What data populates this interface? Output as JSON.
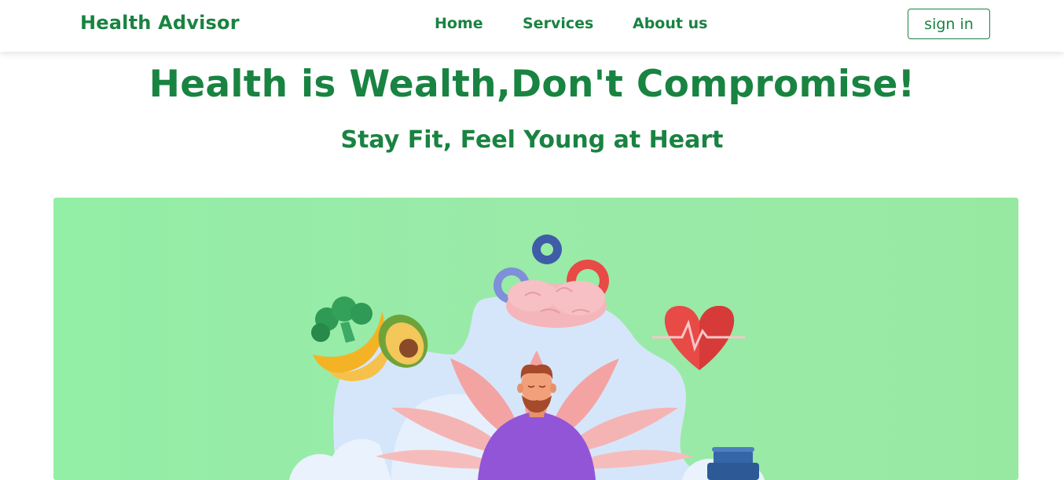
{
  "nav": {
    "brand": "Health Advisor",
    "links": [
      "Home",
      "Services",
      "About us"
    ],
    "signin_label": "sign in"
  },
  "hero": {
    "title": "Health is Wealth,Don't Compromise!",
    "subtitle": "Stay Fit, Feel Young at Heart"
  },
  "illustration": {
    "icons": [
      "broccoli-icon",
      "banana-icon",
      "avocado-icon",
      "brain-icon",
      "gear-icon",
      "heart-pulse-icon",
      "meditating-person-icon",
      "lotus-icon",
      "water-bottle-icon"
    ],
    "colors": {
      "brand_green": "#198341",
      "banner_bg": "#97eca6",
      "cloud": "#d5e6fb",
      "lotus": "#f4a3a3",
      "shirt": "#9255d8",
      "heart": "#e84a46"
    }
  }
}
